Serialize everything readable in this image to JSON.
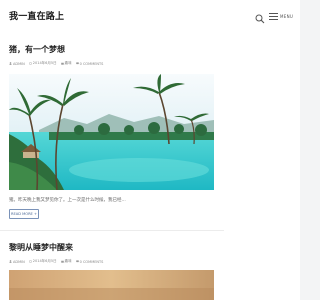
{
  "header": {
    "site_title": "我一直在路上",
    "menu_label": "MENU"
  },
  "posts": [
    {
      "title": "猪，有一个梦想",
      "meta": {
        "author": "ADMIN",
        "date": "2014年6月5日",
        "category": "趣味",
        "comments": "0 COMMENTS"
      },
      "excerpt": "猪。昨天晚上我又梦见你了。上一次是什么时候，我已经...",
      "read_more": "READ MORE +"
    },
    {
      "title": "黎明从睡梦中醒来",
      "meta": {
        "author": "ADMIN",
        "date": "2014年6月5日",
        "category": "趣味",
        "comments": "0 COMMENTS"
      }
    }
  ],
  "colors": {
    "accent": "#4d6a97",
    "sea": "#2fc3c8"
  }
}
